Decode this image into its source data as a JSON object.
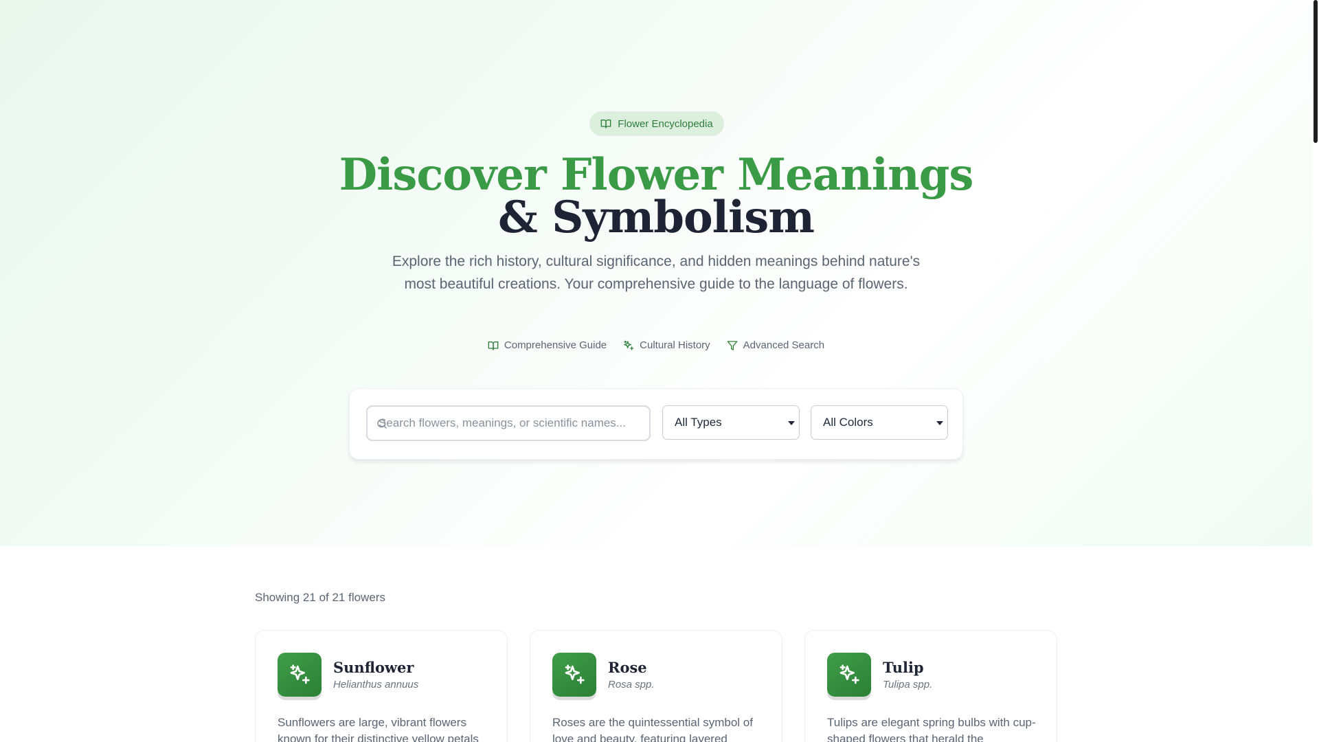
{
  "hero": {
    "badge_label": "Flower Encyclopedia",
    "title_line1": "Discover Flower Meanings",
    "title_line2": "& Symbolism",
    "subtitle": "Explore the rich history, cultural significance, and hidden meanings behind nature's most beautiful creations. Your comprehensive guide to the language of flowers.",
    "features": [
      {
        "label": "Comprehensive Guide",
        "icon": "book-icon"
      },
      {
        "label": "Cultural History",
        "icon": "sparkles-icon"
      },
      {
        "label": "Advanced Search",
        "icon": "filter-icon"
      }
    ]
  },
  "search": {
    "placeholder": "Search flowers, meanings, or scientific names...",
    "type_filter": "All Types",
    "color_filter": "All Colors"
  },
  "results": {
    "count_text": "Showing 21 of 21 flowers"
  },
  "cards": [
    {
      "name": "Sunflower",
      "scientific_name": "Helianthus annuus",
      "description": "Sunflowers are large, vibrant flowers known for their distinctive yellow petals"
    },
    {
      "name": "Rose",
      "scientific_name": "Rosa spp.",
      "description": "Roses are the quintessential symbol of love and beauty, featuring layered"
    },
    {
      "name": "Tulip",
      "scientific_name": "Tulipa spp.",
      "description": "Tulips are elegant spring bulbs with cup-shaped flowers that herald the"
    }
  ],
  "colors": {
    "accent_green": "#3a9a45",
    "dark_green": "#2b7f35",
    "title_dark": "#1e2433"
  }
}
